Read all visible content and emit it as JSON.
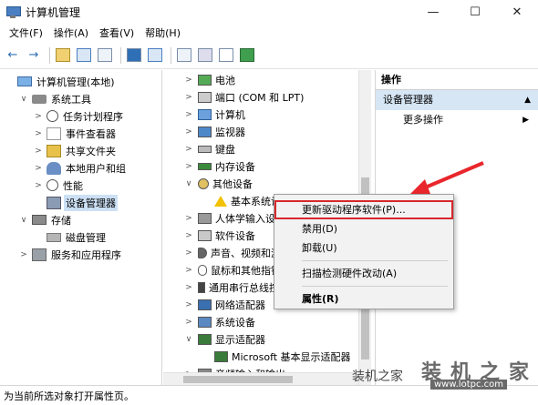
{
  "window": {
    "title": "计算机管理",
    "controls": [
      "—",
      "☐",
      "✕"
    ]
  },
  "menu": [
    "文件(F)",
    "操作(A)",
    "查看(V)",
    "帮助(H)"
  ],
  "toolbar": {
    "back": "←",
    "forward": "→"
  },
  "left_tree": [
    {
      "label": "计算机管理(本地)",
      "toggle": "",
      "icon": "monitor",
      "indent": 0
    },
    {
      "label": "系统工具",
      "toggle": "∨",
      "icon": "tools",
      "indent": 1
    },
    {
      "label": "任务计划程序",
      "toggle": ">",
      "icon": "clock",
      "indent": 2
    },
    {
      "label": "事件查看器",
      "toggle": ">",
      "icon": "log",
      "indent": 2
    },
    {
      "label": "共享文件夹",
      "toggle": ">",
      "icon": "share",
      "indent": 2
    },
    {
      "label": "本地用户和组",
      "toggle": ">",
      "icon": "users",
      "indent": 2
    },
    {
      "label": "性能",
      "toggle": ">",
      "icon": "perf",
      "indent": 2
    },
    {
      "label": "设备管理器",
      "toggle": "",
      "icon": "devmgr",
      "indent": 2,
      "selected": true
    },
    {
      "label": "存储",
      "toggle": "∨",
      "icon": "storage",
      "indent": 1
    },
    {
      "label": "磁盘管理",
      "toggle": "",
      "icon": "disk",
      "indent": 2
    },
    {
      "label": "服务和应用程序",
      "toggle": ">",
      "icon": "services",
      "indent": 1
    }
  ],
  "devices": [
    {
      "label": "电池",
      "toggle": ">",
      "icon": "battery",
      "indent": 0
    },
    {
      "label": "端口 (COM 和 LPT)",
      "toggle": ">",
      "icon": "port",
      "indent": 0
    },
    {
      "label": "计算机",
      "toggle": ">",
      "icon": "computer",
      "indent": 0
    },
    {
      "label": "监视器",
      "toggle": ">",
      "icon": "mon",
      "indent": 0
    },
    {
      "label": "键盘",
      "toggle": ">",
      "icon": "kbd",
      "indent": 0
    },
    {
      "label": "内存设备",
      "toggle": ">",
      "icon": "mem",
      "indent": 0
    },
    {
      "label": "其他设备",
      "toggle": "∨",
      "icon": "other",
      "indent": 0
    },
    {
      "label": "基本系统设备",
      "toggle": "",
      "icon": "warn",
      "indent": 1
    },
    {
      "label": "人体学输入设备",
      "toggle": ">",
      "icon": "hid",
      "indent": 0
    },
    {
      "label": "软件设备",
      "toggle": ">",
      "icon": "sw",
      "indent": 0
    },
    {
      "label": "声音、视频和游戏控制器",
      "toggle": ">",
      "icon": "sound",
      "indent": 0
    },
    {
      "label": "鼠标和其他指针设备",
      "toggle": ">",
      "icon": "mouse",
      "indent": 0
    },
    {
      "label": "通用串行总线控制器",
      "toggle": ">",
      "icon": "usb",
      "indent": 0
    },
    {
      "label": "网络适配器",
      "toggle": ">",
      "icon": "net",
      "indent": 0
    },
    {
      "label": "系统设备",
      "toggle": ">",
      "icon": "sys",
      "indent": 0
    },
    {
      "label": "显示适配器",
      "toggle": "∨",
      "icon": "display",
      "indent": 0
    },
    {
      "label": "Microsoft 基本显示适配器",
      "toggle": "",
      "icon": "display",
      "indent": 1
    },
    {
      "label": "音频输入和输出",
      "toggle": ">",
      "icon": "audio",
      "indent": 0
    }
  ],
  "actions": {
    "header": "操作",
    "section": "设备管理器",
    "section_arrow": "▲",
    "more": "更多操作",
    "more_arrow": "▶"
  },
  "context_menu": {
    "items": [
      {
        "label": "更新驱动程序软件(P)...",
        "highlight": true
      },
      {
        "label": "禁用(D)"
      },
      {
        "label": "卸载(U)"
      },
      {
        "separator": true
      },
      {
        "label": "扫描检测硬件改动(A)"
      },
      {
        "separator": true
      },
      {
        "label": "属性(R)",
        "bold": true
      }
    ]
  },
  "status": "为当前所选对象打开属性页。",
  "watermark": {
    "big": "装机之家",
    "small": "装机之家",
    "url": "www.lotpc.com"
  },
  "colors": {
    "highlight_border": "#d8272d",
    "selection": "#cce0f5",
    "action_section": "#d6e6f5",
    "arrow": "#e8262c"
  }
}
